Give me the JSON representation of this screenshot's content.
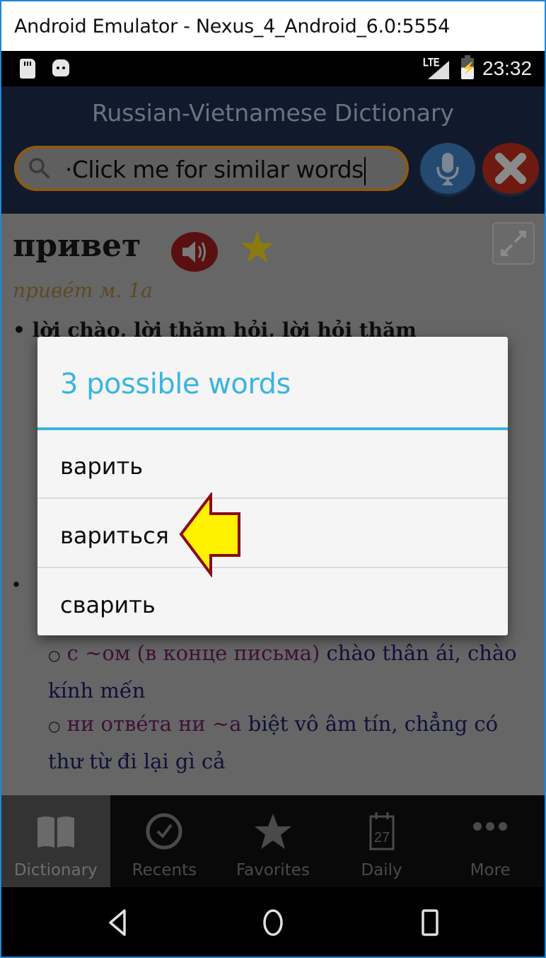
{
  "window": {
    "title": "Android Emulator - Nexus_4_Android_6.0:5554"
  },
  "status_bar": {
    "left_icons": [
      "sd-card-icon",
      "android-debug-icon"
    ],
    "network": "LTE",
    "time": "23:32"
  },
  "header": {
    "title": "Russian-Vietnamese Dictionary",
    "search": {
      "value": "·Click me for similar words",
      "placeholder": ""
    },
    "mic_button": "mic-icon",
    "clear_button": "close-icon"
  },
  "entry": {
    "word": "привет",
    "pronunciation": "приве́т м. 1а",
    "definition_1": "lời chào, lời thăm hỏi, lời hỏi thăm",
    "bullet": "•",
    "examples": [
      {
        "marker": "○",
        "ru": "с ~ом (в конце письма)",
        "vi": "chào thân ái, chào kính mến"
      },
      {
        "marker": "○",
        "ru": "ни отве́та ни ~а",
        "vi": "biệt vô âm tín, chẳng có thư từ đi lại gì cả"
      }
    ]
  },
  "dialog": {
    "title": "3 possible words",
    "accent_color": "#3bb4e0",
    "options": [
      "варить",
      "вариться",
      "сварить"
    ],
    "highlighted_option": "вариться"
  },
  "tabs": [
    {
      "label": "Dictionary",
      "icon": "book-icon",
      "active": true
    },
    {
      "label": "Recents",
      "icon": "clock-check-icon",
      "active": false
    },
    {
      "label": "Favorites",
      "icon": "star-icon",
      "active": false
    },
    {
      "label": "Daily",
      "icon": "calendar-icon",
      "active": false,
      "badge": "27"
    },
    {
      "label": "More",
      "icon": "more-dots-icon",
      "active": false
    }
  ],
  "nav_bar": [
    "back",
    "home",
    "recents"
  ]
}
